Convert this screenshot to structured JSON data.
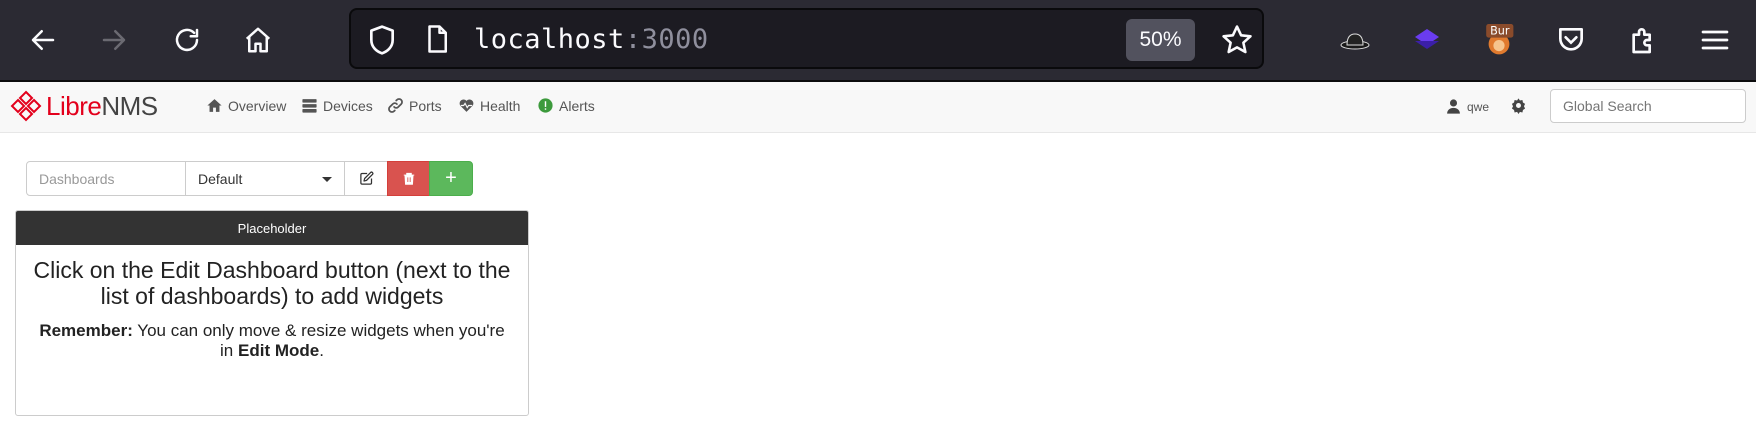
{
  "browser": {
    "url_host": "localhost",
    "url_port": ":3000",
    "zoom": "50%"
  },
  "navbar": {
    "brand_prefix": "Libre",
    "brand_suffix": "NMS",
    "items": [
      {
        "label": "Overview",
        "icon": "home-icon"
      },
      {
        "label": "Devices",
        "icon": "server-icon"
      },
      {
        "label": "Ports",
        "icon": "link-icon"
      },
      {
        "label": "Health",
        "icon": "heartbeat-icon"
      },
      {
        "label": "Alerts",
        "icon": "exclamation-circle-icon"
      }
    ],
    "user": "qwe",
    "search_placeholder": "Global Search"
  },
  "dashboard": {
    "label": "Dashboards",
    "selected": "Default",
    "add_label": "+"
  },
  "widget": {
    "title": "Placeholder",
    "message": "Click on the Edit Dashboard button (next to the list of dashboards) to add widgets",
    "remember_label": "Remember:",
    "remember_text": " You can only move & resize widgets when you're in ",
    "edit_mode": "Edit Mode",
    "period": "."
  },
  "colors": {
    "danger": "#d9534f",
    "success": "#5cb85c",
    "brand_red": "#e3001c",
    "widget_header": "#333333"
  }
}
